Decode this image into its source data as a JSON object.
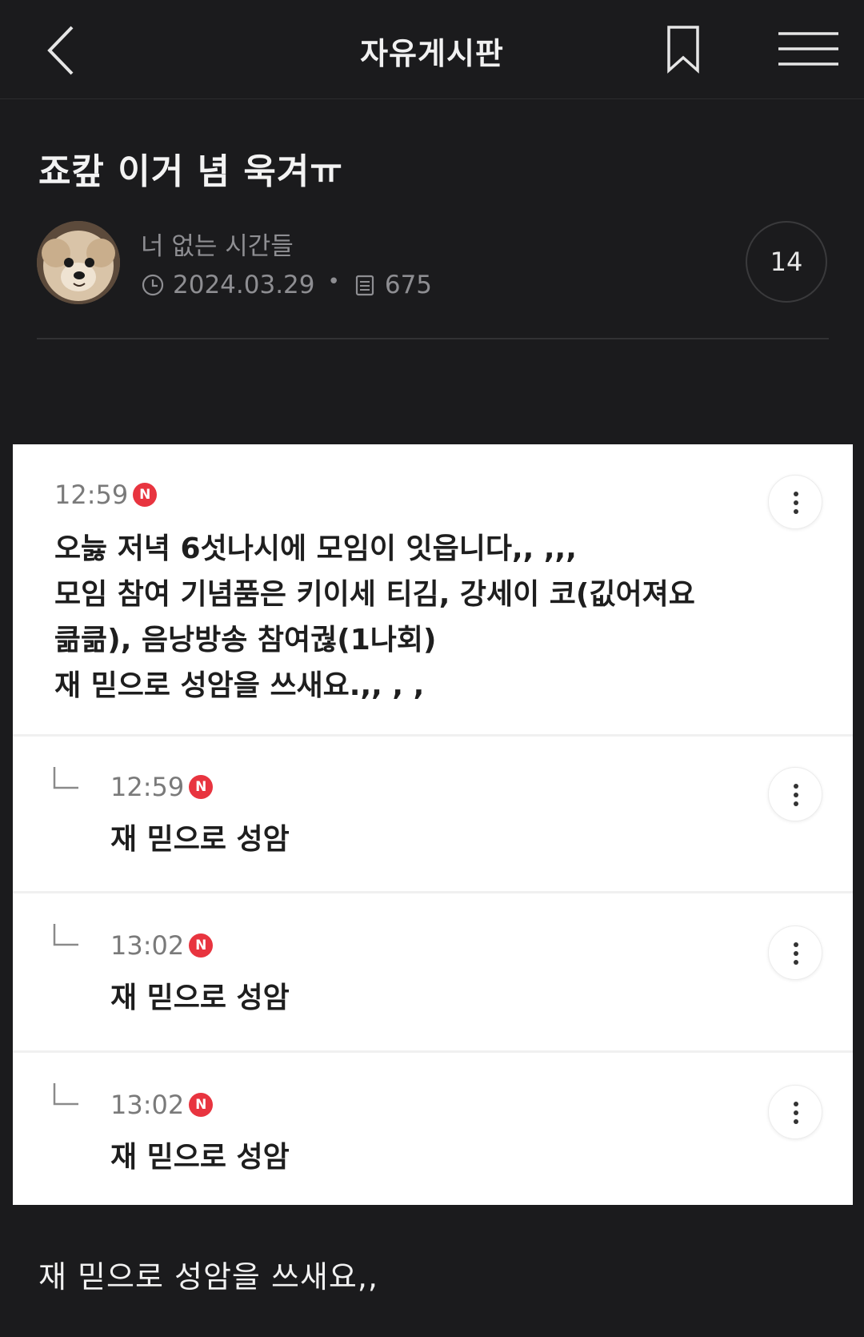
{
  "header": {
    "title": "자유게시판",
    "back_icon": "chevron-left-icon",
    "bookmark_icon": "bookmark-icon",
    "menu_icon": "hamburger-menu-icon"
  },
  "post": {
    "title": "죠캎 이거 념 욱겨ㅠ",
    "author": "너 없는 시간들",
    "date": "2024.03.29",
    "views": "675",
    "comment_count": "14"
  },
  "embedded_screenshot": {
    "comments": [
      {
        "time": "12:59",
        "badge": "N",
        "text": "오늟 저녁 6섯나시에 모임이 잇읍니다,, ,,,\n모임 참여 기념품은 키이세 티김, 강세이 코(깂어져요\n큶큶), 음낭방송 참여궎(1나회)\n재 믿으로 성암을 쓰새요.,, , ,"
      },
      {
        "time": "12:59",
        "badge": "N",
        "text": "재 믿으로 성암"
      },
      {
        "time": "13:02",
        "badge": "N",
        "text": "재 믿으로 성암"
      },
      {
        "time": "13:02",
        "badge": "N",
        "text": "재 믿으로 성암"
      }
    ]
  },
  "body_text": "재 믿으로 성암을 쓰새요,,",
  "colors": {
    "background": "#1b1b1d",
    "new_badge": "#e8343f",
    "muted_text": "#8e8e92"
  }
}
